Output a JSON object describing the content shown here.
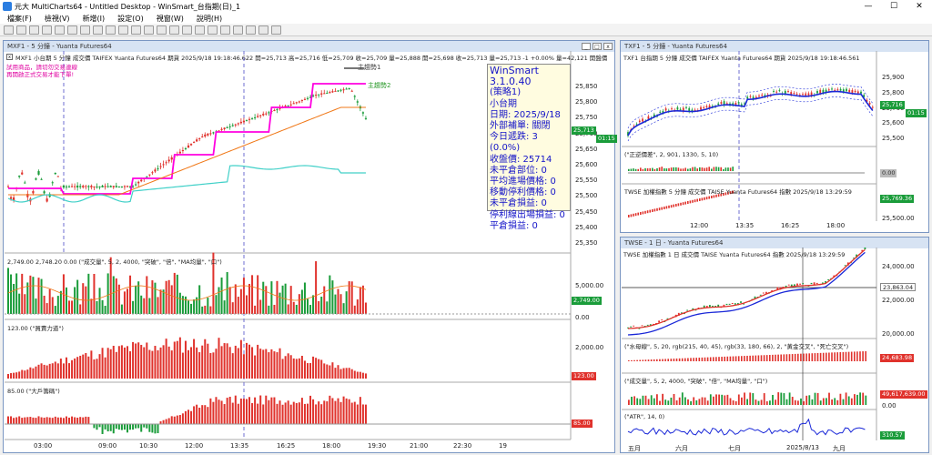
{
  "app": {
    "title": "元大 MultiCharts64 - Untitled Desktop - WinSmart_台指期(日)_1",
    "controls": [
      "—",
      "☐",
      "✕"
    ]
  },
  "menu": [
    "檔案(F)",
    "檢視(V)",
    "新增(I)",
    "設定(O)",
    "視窗(W)",
    "說明(H)"
  ],
  "main_window": {
    "title": "MXF1 - 5 分鐘 - Yuanta Futures64",
    "info": "MXF1  小台期  5 分鐘  成交價  TAIFEX  Yuanta Futures64  期貨  2025/9/18  19:18:46.622  開=25,713  高=25,716  低=25,709  收=25,709  量=25,888  開=25,698  收=25,713  量=25,713  -1  +0.00%  量=42,121  開盤價",
    "warning": [
      "試用商品，請切勿交易連線",
      "再開啟正式交易才能下單!"
    ],
    "labels": {
      "main_line1": "主趨勢1",
      "main_line2": "主趨勢2"
    },
    "price_ticks": [
      "25,850",
      "25,800",
      "25,750",
      "25,700",
      "25,650",
      "25,600",
      "25,550",
      "25,500",
      "25,450",
      "25,400",
      "25,350"
    ],
    "price_tag": "25,713",
    "time_tag": "01:15",
    "vol_info": "2,749.00  2,748.20  0.00  (\"成交量\", 5, 2, 4000, \"突破\", \"倍\", \"MA均量\", \"口\")",
    "vol_ticks": [
      "5,000.00",
      "0.00"
    ],
    "vol_tag": "2,749.00",
    "power_info": "123.00  (\"買賣力道\")",
    "power_ticks": [
      "2,000.00"
    ],
    "power_tag": "123.00",
    "big_info": "85.00  (\"大戶籌碼\")",
    "big_tag": "85.00",
    "x_ticks": [
      "03:00",
      "09:00",
      "10:30",
      "12:00",
      "13:35",
      "16:25",
      "18:00",
      "19:30",
      "21:00",
      "22:30",
      "19"
    ]
  },
  "panel": {
    "title": "WinSmart 3.1.0.40",
    "strategy": "(策略1)",
    "product": "小台期",
    "date": "日期: 2025/9/18",
    "rows": [
      "外部補單: 關閉",
      "今日遞跌: 3 (0.0%)",
      "收盤價: 25714",
      "未平倉部位: 0",
      "平均進場價格: 0",
      "移動停利價格: 0",
      "未平倉損益: 0",
      "停利線出場損益: 0",
      "平倉損益: 0"
    ]
  },
  "txf_window": {
    "title": "TXF1 - 5 分鐘 - Yuanta Futures64",
    "info": "TXF1  台指期  5 分鐘  成交價  TAIFEX  Yuanta Futures64  期貨  2025/9/18  19:18:46.561",
    "price_ticks": [
      "25,900",
      "25,800",
      "25,700",
      "25,600",
      "25,500"
    ],
    "price_tag": "25,716",
    "time_tag": "01:15",
    "sub1": "(\"正逆價差\", 2, 901, 1330, 5, 10)",
    "sub1_tag": "0.00",
    "sub2": "TWSE  加權指數  5 分鐘  成交價  TAISE  Yuanta Futures64  指數  2025/9/18  13:29:59",
    "sub2_ticks": [
      "25,769.36",
      "25,500.00"
    ],
    "x_ticks": [
      "12:00",
      "13:35",
      "16:25",
      "18:00"
    ]
  },
  "twse_window": {
    "title": "TWSE - 1 日 - Yuanta Futures64",
    "info": "TWSE  加權指數  1 日  成交價  TAISE  Yuanta Futures64  指數  2025/9/18  13:29:59",
    "price_ticks": [
      "24,000.00",
      "22,000.00",
      "20,000.00"
    ],
    "price_tag": "23,863.04",
    "ind1": "(\"水母線\", 5, 20, rgb(215, 40, 45), rgb(33, 180, 66), 2, \"黃金交叉\", \"死亡交叉\")",
    "ind1_tag": "24,683.98",
    "ind2": "(\"成交量\", 5, 2, 4000, \"突破\", \"倍\", \"MA均量\", \"口\")",
    "ind2_tag": "49,617,639.00",
    "ind2_tick": "0.00",
    "ind3": "(\"ATR\", 14, 0)",
    "ind3_tag": "310.57",
    "x_ticks": [
      "五月",
      "六月",
      "七月",
      "2025/8/13",
      "九月"
    ]
  },
  "colors": {
    "up": "#e0322c",
    "down": "#1a9c3a",
    "magenta": "#ff00e0",
    "orange": "#f07818",
    "cyan": "#40d0c8",
    "blue": "#1a28d8",
    "tag_red": "#e0322c",
    "tag_green": "#1a9c3a"
  }
}
